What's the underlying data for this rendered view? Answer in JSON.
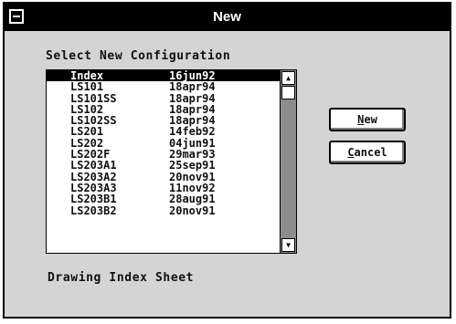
{
  "window": {
    "title": "New"
  },
  "select_label": "Select New Configuration",
  "configurations": [
    {
      "name": "Index",
      "date": "16jun92"
    },
    {
      "name": "LS101",
      "date": "18apr94"
    },
    {
      "name": "LS101SS",
      "date": "18apr94"
    },
    {
      "name": "LS102",
      "date": "18apr94"
    },
    {
      "name": "LS102SS",
      "date": "18apr94"
    },
    {
      "name": "LS201",
      "date": "14feb92"
    },
    {
      "name": "LS202",
      "date": "04jun91"
    },
    {
      "name": "LS202F",
      "date": "29mar93"
    },
    {
      "name": "LS203A1",
      "date": "25sep91"
    },
    {
      "name": "LS203A2",
      "date": "20nov91"
    },
    {
      "name": "LS203A3",
      "date": "11nov92"
    },
    {
      "name": "LS203B1",
      "date": "28aug91"
    },
    {
      "name": "LS203B2",
      "date": "20nov91"
    }
  ],
  "selected_index": 0,
  "buttons": {
    "new": {
      "key": "N",
      "rest": "ew"
    },
    "cancel": {
      "key": "C",
      "rest": "ancel"
    }
  },
  "description": "Drawing Index Sheet",
  "icons": {
    "system_menu": "system-menu-icon",
    "scroll_up": "▲",
    "scroll_down": "▼"
  }
}
